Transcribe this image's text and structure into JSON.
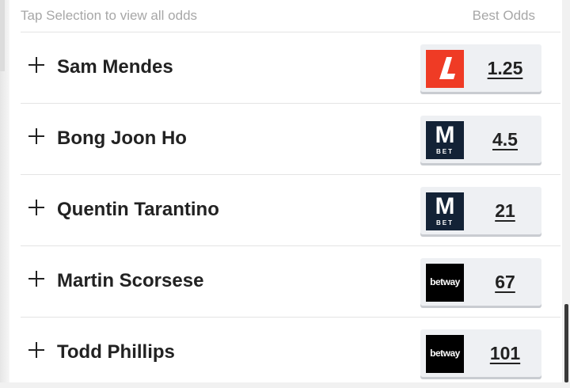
{
  "header": {
    "left_text": "Tap Selection to view all odds",
    "right_text": "Best Odds"
  },
  "rows": [
    {
      "name": "Sam Mendes",
      "odds": "1.25",
      "bookmaker": "ladbrokes",
      "logo_icon": "ladbrokes-logo-icon",
      "logo_text": "",
      "logo_sub": ""
    },
    {
      "name": "Bong Joon Ho",
      "odds": "4.5",
      "bookmaker": "mbet",
      "logo_icon": "mbet-logo-icon",
      "logo_text": "M",
      "logo_sub": "BET"
    },
    {
      "name": "Quentin Tarantino",
      "odds": "21",
      "bookmaker": "mbet",
      "logo_icon": "mbet-logo-icon",
      "logo_text": "M",
      "logo_sub": "BET"
    },
    {
      "name": "Martin Scorsese",
      "odds": "67",
      "bookmaker": "betway",
      "logo_icon": "betway-logo-icon",
      "logo_text": "betway",
      "logo_sub": ""
    },
    {
      "name": "Todd Phillips",
      "odds": "101",
      "bookmaker": "betway",
      "logo_icon": "betway-logo-icon",
      "logo_text": "betway",
      "logo_sub": ""
    }
  ],
  "colors": {
    "ladbrokes": "#ef3b25",
    "mbet": "#132236",
    "betway": "#000000",
    "odds_button_bg": "#eef0f3"
  }
}
